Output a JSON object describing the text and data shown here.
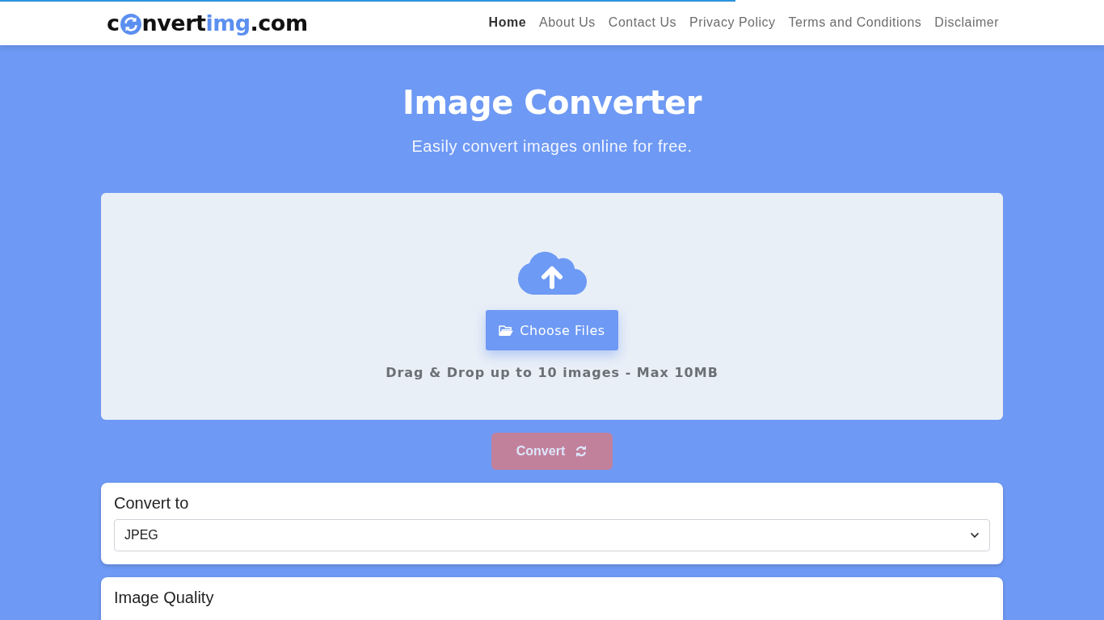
{
  "loading_bar": {
    "level": 0.666
  },
  "logo": {
    "lead": "c",
    "rest": "nvert",
    "accent": "img",
    "suffix": ".com"
  },
  "nav": [
    {
      "label": "Home",
      "selected": true
    },
    {
      "label": "About Us",
      "selected": false
    },
    {
      "label": "Contact Us",
      "selected": false
    },
    {
      "label": "Privacy Policy",
      "selected": false
    },
    {
      "label": "Terms and Conditions",
      "selected": false
    },
    {
      "label": "Disclaimer",
      "selected": false
    }
  ],
  "hero": {
    "title": "Image Converter",
    "subtitle": "Easily convert images online for free."
  },
  "dropzone": {
    "button": "Choose Files",
    "hint": "Drag & Drop up to 10 images - Max 10MB"
  },
  "convert_button": {
    "label": "Convert",
    "disabled": true
  },
  "panels": [
    {
      "title": "Convert to",
      "value": "JPEG"
    },
    {
      "title": "Image Quality"
    }
  ]
}
